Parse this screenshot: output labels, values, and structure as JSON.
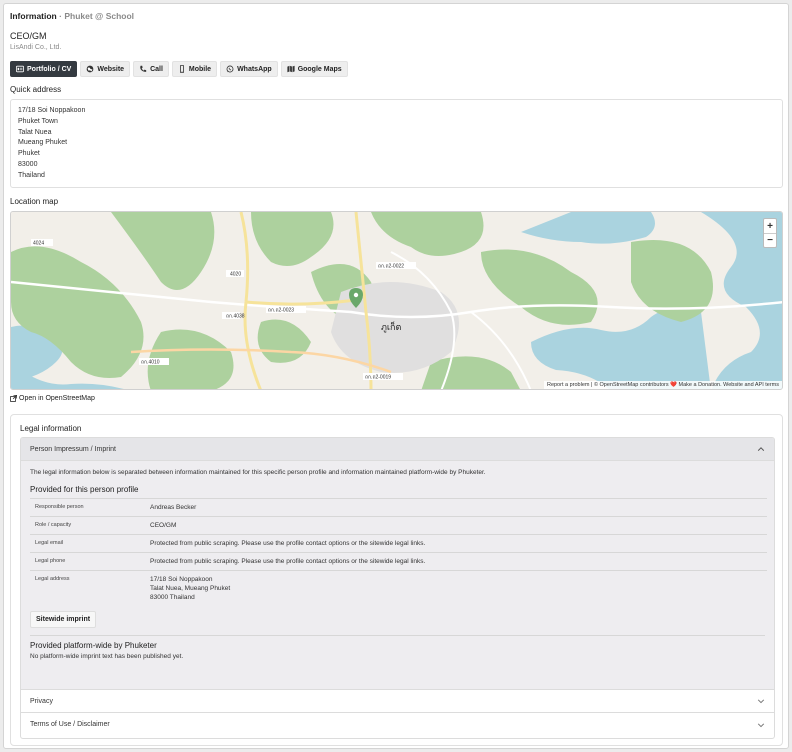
{
  "header": {
    "title": "Information",
    "separator": "·",
    "subtitle": "Phuket @ School"
  },
  "profile": {
    "role": "CEO/GM",
    "company": "LisAndi Co., Ltd."
  },
  "buttons": [
    {
      "label": "Portfolio / CV",
      "icon": "id-card-icon"
    },
    {
      "label": "Website",
      "icon": "globe-icon"
    },
    {
      "label": "Call",
      "icon": "phone-icon"
    },
    {
      "label": "Mobile",
      "icon": "mobile-icon"
    },
    {
      "label": "WhatsApp",
      "icon": "whatsapp-icon"
    },
    {
      "label": "Google Maps",
      "icon": "map-icon"
    }
  ],
  "quick_address": {
    "label": "Quick address",
    "lines": [
      "17/18 Soi Noppakoon",
      "Phuket Town",
      "Talat Nuea",
      "Mueang Phuket",
      "Phuket",
      "83000",
      "Thailand"
    ]
  },
  "map": {
    "label": "Location map",
    "zoom_in": "+",
    "zoom_out": "−",
    "place_labels": [
      "ภูเก็ต",
      "4020",
      "4024",
      "ถก.4038",
      "ถก.ถ2-0023",
      "ถก.ถ2-0022",
      "ถก.4010",
      "ถก.ถ2-0019"
    ],
    "attribution": "Report a problem | © OpenStreetMap contributors ❤️ Make a Donation. Website and API terms",
    "open_link": "Open in OpenStreetMap"
  },
  "legal": {
    "title": "Legal information",
    "accordion": [
      {
        "label": "Person Impressum / Imprint"
      },
      {
        "label": "Privacy"
      },
      {
        "label": "Terms of Use / Disclaimer"
      }
    ],
    "intro": "The legal information below is separated between information maintained for this specific person profile and information maintained platform-wide by Phuketer.",
    "person_heading": "Provided for this person profile",
    "rows": [
      {
        "key": "Responsible person",
        "value": "Andreas Becker"
      },
      {
        "key": "Role / capacity",
        "value": "CEO/GM"
      },
      {
        "key": "Legal email",
        "value": "Protected from public scraping. Please use the profile contact options or the sitewide legal links."
      },
      {
        "key": "Legal phone",
        "value": "Protected from public scraping. Please use the profile contact options or the sitewide legal links."
      },
      {
        "key": "Legal address",
        "value": "17/18 Soi Noppakoon\nTalat Nuea, Mueang Phuket\n83000 Thailand"
      }
    ],
    "imprint_button": "Sitewide imprint",
    "platform_heading": "Provided platform-wide by Phuketer",
    "platform_text": "No platform-wide imprint text has been published yet."
  },
  "colors": {
    "dark_button": "#343a40",
    "water": "#aad3df",
    "forest": "#add19e",
    "marker": "#6aa86a"
  }
}
